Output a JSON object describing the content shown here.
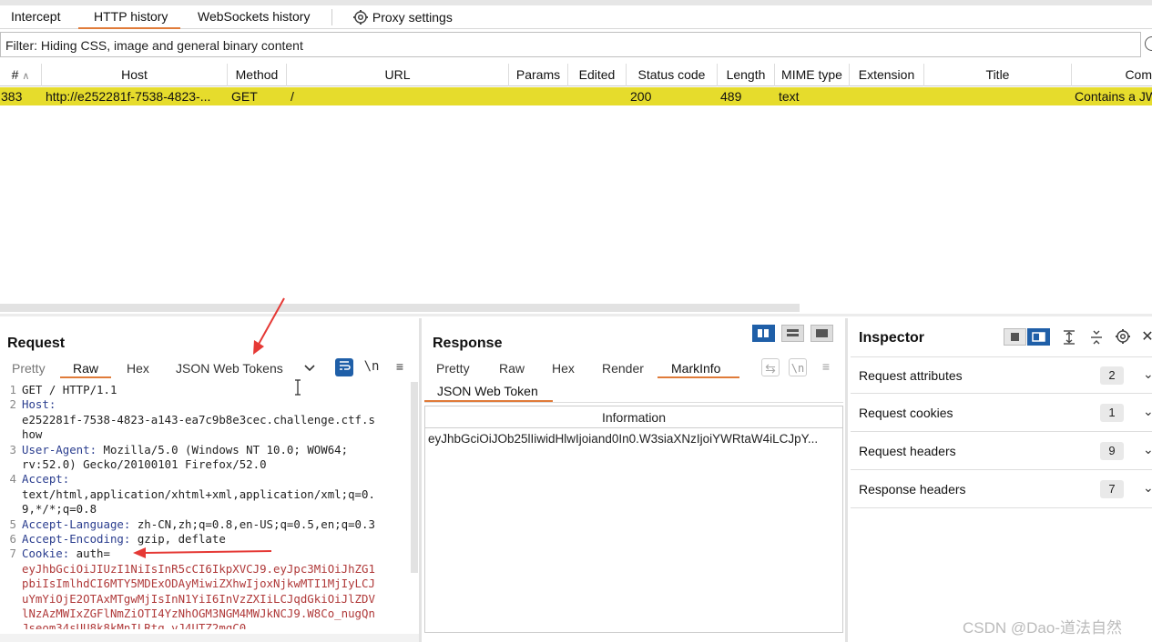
{
  "tabs": [
    "Intercept",
    "HTTP history",
    "WebSockets history",
    "Proxy settings"
  ],
  "filter": "Filter: Hiding CSS, image and general binary content",
  "table": {
    "headers": [
      "#",
      "Host",
      "Method",
      "URL",
      "Params",
      "Edited",
      "Status code",
      "Length",
      "MIME type",
      "Extension",
      "Title",
      "Com"
    ],
    "row": {
      "num": "383",
      "host": "http://e252281f-7538-4823-...",
      "method": "GET",
      "url": "/",
      "status": "200",
      "length": "489",
      "mime": "text",
      "title": "Contains a JW"
    }
  },
  "request": {
    "title": "Request",
    "tabs": [
      "Pretty",
      "Raw",
      "Hex",
      "JSON Web Tokens"
    ],
    "lines": [
      {
        "n": "1",
        "name": "",
        "value": "GET / HTTP/1.1"
      },
      {
        "n": "2",
        "name": "Host:",
        "value": ""
      },
      {
        "n": "",
        "name": "",
        "value": "e252281f-7538-4823-a143-ea7c9b8e3cec.challenge.ctf.s"
      },
      {
        "n": "",
        "name": "",
        "value": "how"
      },
      {
        "n": "3",
        "name": "User-Agent:",
        "value": " Mozilla/5.0 (Windows NT 10.0; WOW64;"
      },
      {
        "n": "",
        "name": "",
        "value": "rv:52.0) Gecko/20100101 Firefox/52.0"
      },
      {
        "n": "4",
        "name": "Accept:",
        "value": ""
      },
      {
        "n": "",
        "name": "",
        "value": "text/html,application/xhtml+xml,application/xml;q=0."
      },
      {
        "n": "",
        "name": "",
        "value": "9,*/*;q=0.8"
      },
      {
        "n": "5",
        "name": "Accept-Language:",
        "value": " zh-CN,zh;q=0.8,en-US;q=0.5,en;q=0.3"
      },
      {
        "n": "6",
        "name": "Accept-Encoding:",
        "value": " gzip, deflate"
      },
      {
        "n": "7",
        "name": "Cookie:",
        "value": " auth="
      }
    ],
    "cookie": [
      "eyJhbGciOiJIUzI1NiIsInR5cCI6IkpXVCJ9.eyJpc3MiOiJhZG1",
      "pbiIsImlhdCI6MTY5MDExODAyMiwiZXhwIjoxNjkwMTI1MjIyLCJ",
      "uYmYiOjE2OTAxMTgwMjIsInN1YiI6InVzZXIiLCJqdGkiOiJlZDV",
      "lNzAzMWIxZGFlNmZiOTI4YzNhOGM3NGM4MWJkNCJ9.W8Co_nugQn",
      "Jseom34sUU8k8kMnILRtg_vJ4UTZ2mqC0"
    ]
  },
  "response": {
    "title": "Response",
    "tabs": [
      "Pretty",
      "Raw",
      "Hex",
      "Render",
      "MarkInfo"
    ],
    "jwt_tab": "JSON Web Token",
    "info_header": "Information",
    "info_value": "eyJhbGciOiJOb25lIiwidHlwIjoiand0In0.W3siaXNzIjoiYWRtaW4iLCJpY..."
  },
  "inspector": {
    "title": "Inspector",
    "rows": [
      {
        "label": "Request attributes",
        "count": "2"
      },
      {
        "label": "Request cookies",
        "count": "1"
      },
      {
        "label": "Request headers",
        "count": "9"
      },
      {
        "label": "Response headers",
        "count": "7"
      }
    ]
  },
  "watermark": "CSDN @Dao-道法自然",
  "colors": {
    "highlight": "#e6dc2c",
    "accent": "#e07b39",
    "header_name": "#2b3e8f",
    "cookie_value": "#b03a3a",
    "annotation": "#e53935"
  }
}
